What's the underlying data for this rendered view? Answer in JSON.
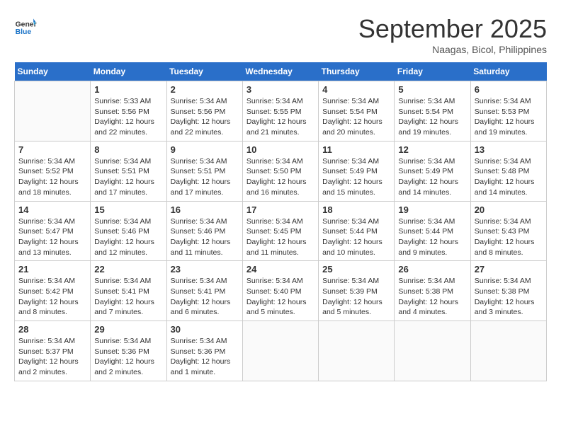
{
  "logo": {
    "line1": "General",
    "line2": "Blue"
  },
  "title": "September 2025",
  "location": "Naagas, Bicol, Philippines",
  "weekdays": [
    "Sunday",
    "Monday",
    "Tuesday",
    "Wednesday",
    "Thursday",
    "Friday",
    "Saturday"
  ],
  "weeks": [
    [
      {
        "day": "",
        "info": ""
      },
      {
        "day": "1",
        "info": "Sunrise: 5:33 AM\nSunset: 5:56 PM\nDaylight: 12 hours\nand 22 minutes."
      },
      {
        "day": "2",
        "info": "Sunrise: 5:34 AM\nSunset: 5:56 PM\nDaylight: 12 hours\nand 22 minutes."
      },
      {
        "day": "3",
        "info": "Sunrise: 5:34 AM\nSunset: 5:55 PM\nDaylight: 12 hours\nand 21 minutes."
      },
      {
        "day": "4",
        "info": "Sunrise: 5:34 AM\nSunset: 5:54 PM\nDaylight: 12 hours\nand 20 minutes."
      },
      {
        "day": "5",
        "info": "Sunrise: 5:34 AM\nSunset: 5:54 PM\nDaylight: 12 hours\nand 19 minutes."
      },
      {
        "day": "6",
        "info": "Sunrise: 5:34 AM\nSunset: 5:53 PM\nDaylight: 12 hours\nand 19 minutes."
      }
    ],
    [
      {
        "day": "7",
        "info": "Sunrise: 5:34 AM\nSunset: 5:52 PM\nDaylight: 12 hours\nand 18 minutes."
      },
      {
        "day": "8",
        "info": "Sunrise: 5:34 AM\nSunset: 5:51 PM\nDaylight: 12 hours\nand 17 minutes."
      },
      {
        "day": "9",
        "info": "Sunrise: 5:34 AM\nSunset: 5:51 PM\nDaylight: 12 hours\nand 17 minutes."
      },
      {
        "day": "10",
        "info": "Sunrise: 5:34 AM\nSunset: 5:50 PM\nDaylight: 12 hours\nand 16 minutes."
      },
      {
        "day": "11",
        "info": "Sunrise: 5:34 AM\nSunset: 5:49 PM\nDaylight: 12 hours\nand 15 minutes."
      },
      {
        "day": "12",
        "info": "Sunrise: 5:34 AM\nSunset: 5:49 PM\nDaylight: 12 hours\nand 14 minutes."
      },
      {
        "day": "13",
        "info": "Sunrise: 5:34 AM\nSunset: 5:48 PM\nDaylight: 12 hours\nand 14 minutes."
      }
    ],
    [
      {
        "day": "14",
        "info": "Sunrise: 5:34 AM\nSunset: 5:47 PM\nDaylight: 12 hours\nand 13 minutes."
      },
      {
        "day": "15",
        "info": "Sunrise: 5:34 AM\nSunset: 5:46 PM\nDaylight: 12 hours\nand 12 minutes."
      },
      {
        "day": "16",
        "info": "Sunrise: 5:34 AM\nSunset: 5:46 PM\nDaylight: 12 hours\nand 11 minutes."
      },
      {
        "day": "17",
        "info": "Sunrise: 5:34 AM\nSunset: 5:45 PM\nDaylight: 12 hours\nand 11 minutes."
      },
      {
        "day": "18",
        "info": "Sunrise: 5:34 AM\nSunset: 5:44 PM\nDaylight: 12 hours\nand 10 minutes."
      },
      {
        "day": "19",
        "info": "Sunrise: 5:34 AM\nSunset: 5:44 PM\nDaylight: 12 hours\nand 9 minutes."
      },
      {
        "day": "20",
        "info": "Sunrise: 5:34 AM\nSunset: 5:43 PM\nDaylight: 12 hours\nand 8 minutes."
      }
    ],
    [
      {
        "day": "21",
        "info": "Sunrise: 5:34 AM\nSunset: 5:42 PM\nDaylight: 12 hours\nand 8 minutes."
      },
      {
        "day": "22",
        "info": "Sunrise: 5:34 AM\nSunset: 5:41 PM\nDaylight: 12 hours\nand 7 minutes."
      },
      {
        "day": "23",
        "info": "Sunrise: 5:34 AM\nSunset: 5:41 PM\nDaylight: 12 hours\nand 6 minutes."
      },
      {
        "day": "24",
        "info": "Sunrise: 5:34 AM\nSunset: 5:40 PM\nDaylight: 12 hours\nand 5 minutes."
      },
      {
        "day": "25",
        "info": "Sunrise: 5:34 AM\nSunset: 5:39 PM\nDaylight: 12 hours\nand 5 minutes."
      },
      {
        "day": "26",
        "info": "Sunrise: 5:34 AM\nSunset: 5:38 PM\nDaylight: 12 hours\nand 4 minutes."
      },
      {
        "day": "27",
        "info": "Sunrise: 5:34 AM\nSunset: 5:38 PM\nDaylight: 12 hours\nand 3 minutes."
      }
    ],
    [
      {
        "day": "28",
        "info": "Sunrise: 5:34 AM\nSunset: 5:37 PM\nDaylight: 12 hours\nand 2 minutes."
      },
      {
        "day": "29",
        "info": "Sunrise: 5:34 AM\nSunset: 5:36 PM\nDaylight: 12 hours\nand 2 minutes."
      },
      {
        "day": "30",
        "info": "Sunrise: 5:34 AM\nSunset: 5:36 PM\nDaylight: 12 hours\nand 1 minute."
      },
      {
        "day": "",
        "info": ""
      },
      {
        "day": "",
        "info": ""
      },
      {
        "day": "",
        "info": ""
      },
      {
        "day": "",
        "info": ""
      }
    ]
  ]
}
